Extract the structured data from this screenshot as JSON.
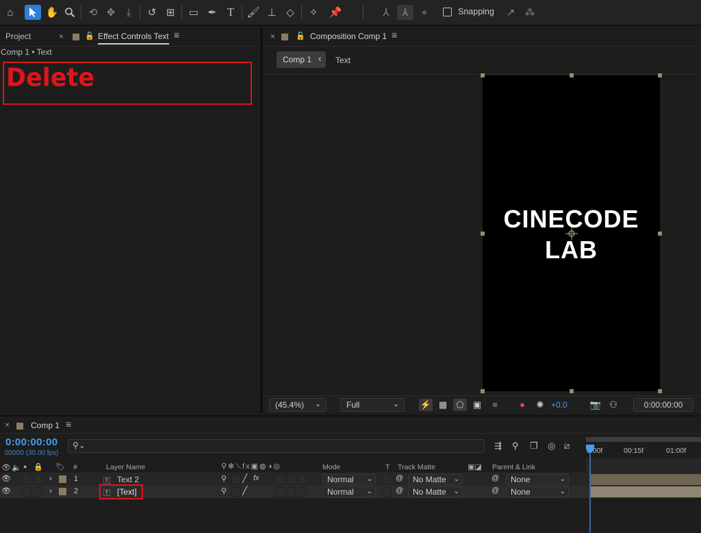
{
  "toolbar": {
    "snapping_label": "Snapping",
    "icons": [
      "home-icon",
      "selection-tool-icon",
      "hand-tool-icon",
      "zoom-tool-icon",
      "orbit-camera-icon",
      "pan-camera-icon",
      "dolly-camera-icon",
      "rotate-tool-icon",
      "pan-behind-icon",
      "rectangle-tool-icon",
      "pen-tool-icon",
      "type-tool-icon",
      "brush-tool-icon",
      "clone-stamp-icon",
      "eraser-tool-icon",
      "roto-brush-icon",
      "puppet-pin-icon"
    ]
  },
  "left_panel": {
    "tab_project": "Project",
    "tab_effect_controls": "Effect Controls Text",
    "breadcrumb": "Comp 1 • Text",
    "annotation": "Delete"
  },
  "comp_panel": {
    "tab_title": "Composition Comp 1",
    "nav_comp": "Comp 1",
    "nav_layer": "Text",
    "line1": "CINECODE",
    "line2": "LAB",
    "zoom": "(45.4%)",
    "resolution": "Full",
    "exposure": "+0.0",
    "timecode": "0:00:00:00"
  },
  "timeline": {
    "tab_title": "Comp 1",
    "timecode": "0:00:00:00",
    "frame_info": "00000 (30.00 fps)",
    "search_placeholder": "",
    "headers": {
      "num": "#",
      "layer_name": "Layer Name",
      "mode": "Mode",
      "t": "T",
      "track_matte": "Track Matte",
      "parent_link": "Parent & Link"
    },
    "ruler": [
      "0:00f",
      "00:15f",
      "01:00f"
    ],
    "layers": [
      {
        "num": "1",
        "name": "Text 2",
        "mode": "Normal",
        "matte": "No Matte",
        "parent": "None"
      },
      {
        "num": "2",
        "name": "[Text]",
        "mode": "Normal",
        "matte": "No Matte",
        "parent": "None"
      }
    ]
  },
  "colors": {
    "accent": "#2d7fd9",
    "annotation_red": "#e0141a",
    "label_tan": "#8a7b62"
  }
}
